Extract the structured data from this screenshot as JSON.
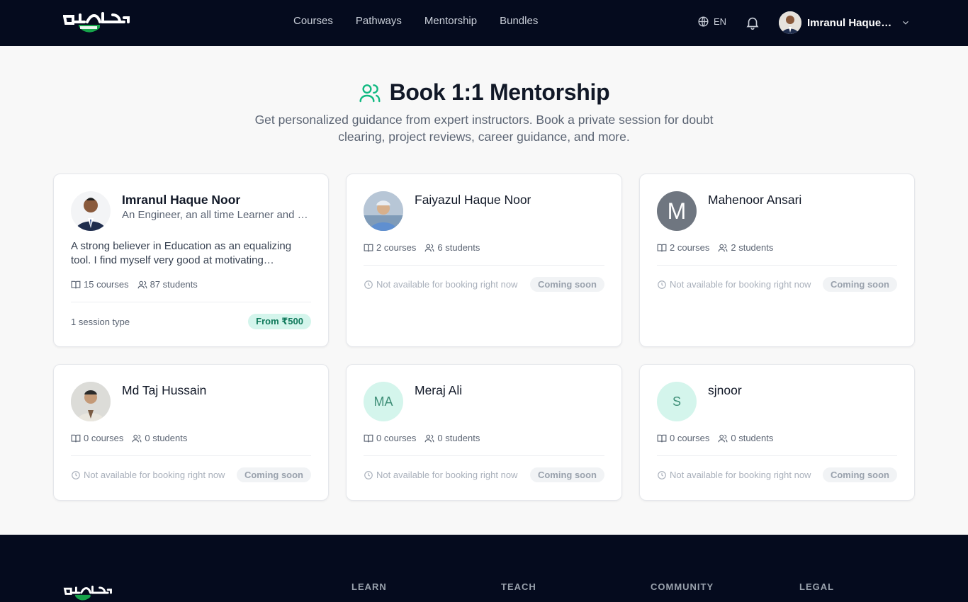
{
  "header": {
    "logo_alt": "মাদ্রাসা",
    "nav": [
      "Courses",
      "Pathways",
      "Mentorship",
      "Bundles"
    ],
    "lang": "EN",
    "user_name": "Imranul Haque Noor"
  },
  "page": {
    "title": "Book 1:1 Mentorship",
    "subtitle": "Get personalized guidance from expert instructors. Book a private session for doubt clearing, project reviews, career guidance, and more."
  },
  "mentors": [
    {
      "name": "Imranul Haque Noor",
      "tagline": "An Engineer, an all time Learner and a Teacher",
      "bio": "A strong believer in Education as an equalizing tool. I find myself very good at motivating students to learn and grow.",
      "courses": "15 courses",
      "students": "87 students",
      "session_types": "1 session type",
      "price": "From ₹500"
    },
    {
      "name": "Faiyazul Haque Noor",
      "courses": "2 courses",
      "students": "6 students",
      "availability": "Not available for booking right now",
      "status": "Coming soon"
    },
    {
      "name": "Mahenoor Ansari",
      "initials": "M",
      "courses": "2 courses",
      "students": "2 students",
      "availability": "Not available for booking right now",
      "status": "Coming soon"
    },
    {
      "name": "Md Taj Hussain",
      "courses": "0 courses",
      "students": "0 students",
      "availability": "Not available for booking right now",
      "status": "Coming soon"
    },
    {
      "name": "Meraj Ali",
      "initials": "MA",
      "courses": "0 courses",
      "students": "0 students",
      "availability": "Not available for booking right now",
      "status": "Coming soon"
    },
    {
      "name": "sjnoor",
      "initials": "S",
      "courses": "0 courses",
      "students": "0 students",
      "availability": "Not available for booking right now",
      "status": "Coming soon"
    }
  ],
  "footer": {
    "columns": [
      "LEARN",
      "TEACH",
      "COMMUNITY",
      "LEGAL"
    ]
  },
  "colors": {
    "header_bg": "#050b1e",
    "accent": "#10b981",
    "page_bg": "#f8f8f8"
  }
}
